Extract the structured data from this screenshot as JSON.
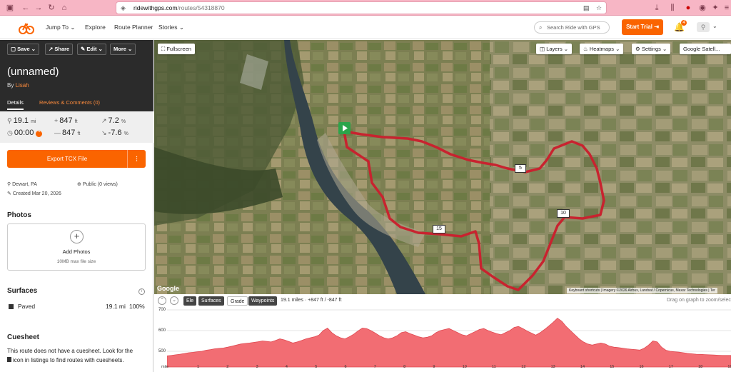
{
  "browser": {
    "url_host": "ridewithgps.com",
    "url_path": "/routes/54318870"
  },
  "nav": {
    "items": [
      "Jump To",
      "Explore",
      "Route Planner",
      "Stories"
    ],
    "search_placeholder": "Search Ride with GPS",
    "start_trial": "Start Trial",
    "notifications": "4"
  },
  "route": {
    "toolbar": [
      "Save",
      "Share",
      "Edit",
      "More"
    ],
    "name": "(unnamed)",
    "by": "By",
    "author": "Lisah",
    "tabs": [
      "Details",
      "Reviews & Comments (0)"
    ],
    "stats": {
      "distance": "19.1",
      "distance_unit": "mi",
      "elev_gain": "847",
      "elev_gain_unit": "ft",
      "grade_up": "7.2",
      "grade_up_unit": "%",
      "time": "00:00",
      "elev_loss": "847",
      "elev_loss_unit": "ft",
      "grade_down": "-7.6",
      "grade_down_unit": "%"
    },
    "export_label": "Export TCX File",
    "location": "Dewart, PA",
    "privacy": "Public (0 views)",
    "created": "Created Mar 20, 2026"
  },
  "photos": {
    "heading": "Photos",
    "add": "Add Photos",
    "max": "10MB max file size"
  },
  "surfaces": {
    "heading": "Surfaces",
    "name": "Paved",
    "distance": "19.1 mi",
    "percent": "100%"
  },
  "cuesheet": {
    "heading": "Cuesheet",
    "text": "This route does not have a cuesheet. Look for the",
    "text2": "icon in listings to find routes with cuesheets."
  },
  "map": {
    "fullscreen": "Fullscreen",
    "controls": [
      "Layers",
      "Heatmaps",
      "Settings",
      "Google Satell..."
    ],
    "markers": [
      "5",
      "10",
      "15"
    ],
    "google": "Google",
    "attribution": "Keyboard shortcuts  |  Imagery ©2026 Airbus, Landsat / Copernicus, Maxar Technologies  |  Ter"
  },
  "elevation": {
    "buttons": [
      "Ele",
      "Surfaces",
      "Grade",
      "Waypoints"
    ],
    "summary": "19.1 miles · +847 ft / -847 ft",
    "hint": "Drag on graph to zoom/selec",
    "y_ticks": [
      "700",
      "600",
      "500"
    ],
    "x_ticks": [
      "1",
      "2",
      "3",
      "4",
      "5",
      "6",
      "7",
      "8",
      "9",
      "10",
      "11",
      "12",
      "13",
      "14",
      "15",
      "16",
      "17",
      "18",
      "19"
    ],
    "x_unit": "mile",
    "fill_color": "#f26d73",
    "profile": [
      478,
      480,
      483,
      486,
      489,
      493,
      495,
      498,
      500,
      505,
      508,
      512,
      514,
      516,
      520,
      525,
      530,
      535,
      538,
      540,
      543,
      546,
      550,
      548,
      545,
      552,
      560,
      555,
      548,
      540,
      545,
      552,
      560,
      565,
      570,
      578,
      600,
      612,
      590,
      575,
      565,
      560,
      570,
      582,
      598,
      612,
      610,
      600,
      588,
      575,
      565,
      560,
      565,
      575,
      590,
      595,
      585,
      578,
      570,
      565,
      568,
      575,
      590,
      600,
      605,
      610,
      600,
      590,
      580,
      575,
      585,
      595,
      605,
      610,
      600,
      592,
      585,
      580,
      590,
      600,
      615,
      620,
      610,
      598,
      588,
      578,
      590,
      605,
      622,
      640,
      660,
      645,
      620,
      600,
      580,
      560,
      545,
      535,
      530,
      535,
      540,
      535,
      525,
      520,
      518,
      515,
      512,
      510,
      508,
      506,
      515,
      530,
      550,
      545,
      520,
      505,
      500,
      498,
      496,
      493,
      490,
      488,
      486,
      485,
      484,
      483,
      482,
      481,
      480,
      480,
      480
    ]
  }
}
